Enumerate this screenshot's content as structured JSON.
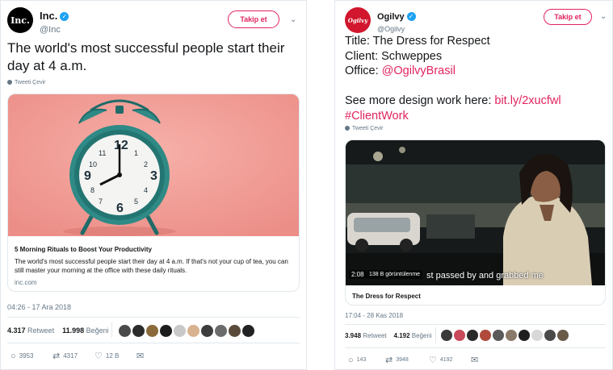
{
  "left_tweet": {
    "display_name": "Inc.",
    "handle": "@Inc",
    "avatar_text": "Inc.",
    "follow_label": "Takip et",
    "text": "The world's most successful people start their day at 4 a.m.",
    "translate_label": "Tweeti Çevir",
    "card": {
      "title": "5 Morning Rituals to Boost Your Productivity",
      "description": "The world's most successful people start their day at 4 a.m. If that's not your cup of tea, you can still master your morning at the office with these daily rituals.",
      "domain": "inc.com"
    },
    "timestamp": "04:26 - 17 Ara 2018",
    "retweets": "4.317",
    "retweets_label": "Retweet",
    "likes": "11.998",
    "likes_label": "Beğeni",
    "actions": {
      "replies": "3953",
      "retweets": "4317",
      "likes": "12 B"
    }
  },
  "right_tweet": {
    "display_name": "Ogilvy",
    "handle": "@Ogilvy",
    "avatar_text": "Ogilvy",
    "follow_label": "Takip et",
    "line1": "Title: The Dress for Respect",
    "line2": "Client: Schweppes",
    "line3_prefix": "Office: ",
    "line3_link": "@OgilvyBrasil",
    "line4_prefix": "See more design work here: ",
    "line4_link": "bit.ly/2xucfwl",
    "line5_link": "#ClientWork",
    "translate_label": "Tweeti Çevir",
    "video": {
      "duration": "2:08",
      "views": "138 B görüntülenme",
      "subtitle": "st passed by and grabbed me",
      "title": "The Dress for Respect"
    },
    "timestamp": "17:04 - 28 Kas 2018",
    "retweets": "3.948",
    "retweets_label": "Retweet",
    "likes": "4.192",
    "likes_label": "Beğeni",
    "actions": {
      "replies": "143",
      "retweets": "3948",
      "likes": "4192"
    }
  },
  "colors": {
    "accent": "#e0245e",
    "verified": "#1da1f2",
    "muted": "#657786",
    "clock_teal": "#2f8a86",
    "clock_bg": "#f2a09a"
  },
  "icons": [
    "verified-badge-icon",
    "chevron-down-icon",
    "globe-icon",
    "reply-icon",
    "retweet-icon",
    "like-icon",
    "message-icon",
    "play-icon"
  ]
}
